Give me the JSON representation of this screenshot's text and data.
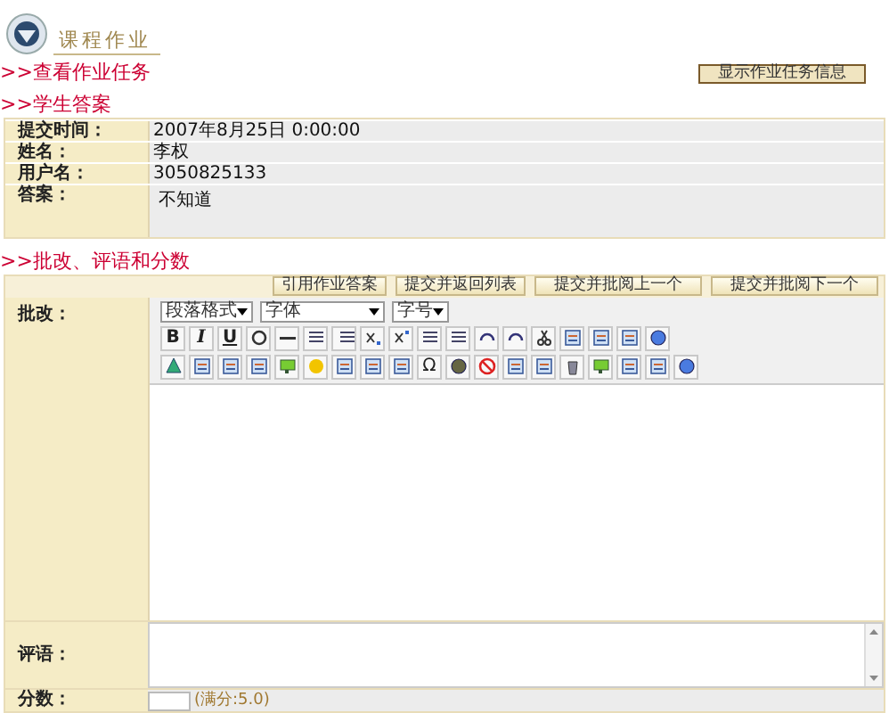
{
  "header": {
    "title": "课程作业"
  },
  "task_heading": ">>查看作业任务",
  "show_task_button": "显示作业任务信息",
  "answer_heading": ">>学生答案",
  "answer_rows": [
    {
      "label": "提交时间：",
      "value": "2007年8月25日 0:00:00"
    },
    {
      "label": "姓名：",
      "value": "李权"
    },
    {
      "label": "用户名：",
      "value": "3050825133"
    },
    {
      "label": "答案：",
      "value": "不知道"
    }
  ],
  "grading_heading": ">>批改、评语和分数",
  "grading": {
    "actions": [
      "引用作业答案",
      "提交并返回列表",
      "提交并批阅上一个",
      "提交并批阅下一个"
    ],
    "review_label": "批改：",
    "format_select": "段落格式",
    "font_select": "字体",
    "size_select": "字号",
    "toolbar_rows": [
      [
        {
          "kind": "bold",
          "label": "B"
        },
        {
          "kind": "italic",
          "label": "I"
        },
        {
          "kind": "underline",
          "label": "U"
        },
        {
          "kind": "icon"
        },
        {
          "kind": "icon"
        },
        {
          "kind": "icon"
        },
        {
          "kind": "icon"
        },
        {
          "kind": "icon"
        },
        {
          "kind": "icon"
        },
        {
          "kind": "icon"
        },
        {
          "kind": "icon"
        },
        {
          "kind": "icon"
        },
        {
          "kind": "icon"
        },
        {
          "kind": "icon"
        },
        {
          "kind": "icon"
        },
        {
          "kind": "icon"
        },
        {
          "kind": "icon"
        },
        {
          "kind": "icon"
        }
      ],
      [
        {
          "kind": "icon"
        },
        {
          "kind": "icon"
        },
        {
          "kind": "icon"
        },
        {
          "kind": "icon"
        },
        {
          "kind": "icon"
        },
        {
          "kind": "icon"
        },
        {
          "kind": "icon"
        },
        {
          "kind": "icon"
        },
        {
          "kind": "icon"
        },
        {
          "kind": "symbol",
          "label": "Ω"
        },
        {
          "kind": "icon"
        },
        {
          "kind": "icon"
        },
        {
          "kind": "icon"
        },
        {
          "kind": "icon"
        },
        {
          "kind": "icon"
        },
        {
          "kind": "icon"
        },
        {
          "kind": "icon"
        },
        {
          "kind": "icon"
        },
        {
          "kind": "icon"
        }
      ]
    ],
    "comment_label": "评语：",
    "score_label": "分数：",
    "score_hint": "(满分:5.0)"
  }
}
